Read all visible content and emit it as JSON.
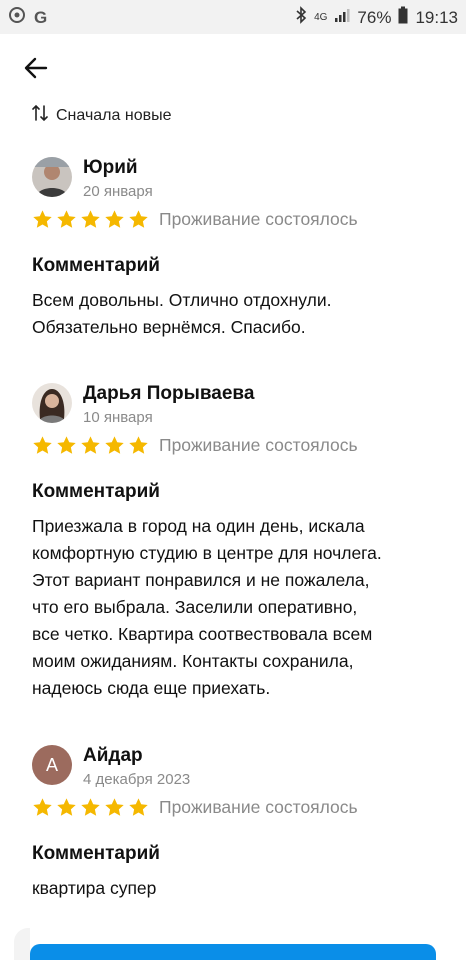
{
  "status_bar": {
    "battery": "76%",
    "time": "19:13",
    "network": "4G"
  },
  "sort": {
    "label": "Сначала новые"
  },
  "reviews": [
    {
      "name": "Юрий",
      "date": "20 января",
      "rating": 5,
      "stay": "Проживание состоялось",
      "comment_label": "Комментарий",
      "comment_lines": [
        "Всем довольны. Отлично отдохнули.",
        "Обязательно вернёмся. Спасибо."
      ]
    },
    {
      "name": "Дарья Порываева",
      "date": "10 января",
      "rating": 5,
      "stay": "Проживание состоялось",
      "comment_label": "Комментарий",
      "comment_lines": [
        "Приезжала в город на один день, искала",
        "комфортную студию в центре для ночлега.",
        "Этот вариант понравился и не пожалела,",
        "что его выбрала. Заселили оперативно,",
        "все четко. Квартира соотвествовала всем",
        "моим ожиданиям. Контакты сохранила,",
        "надеюсь сюда еще приехать."
      ]
    },
    {
      "name": "Айдар",
      "avatar_letter": "А",
      "date": "4 декабря 2023",
      "rating": 5,
      "stay": "Проживание состоялось",
      "comment_label": "Комментарий",
      "comment_lines": [
        "квартира супер"
      ]
    }
  ],
  "colors": {
    "star": "#f5b800",
    "accent": "#0a8ee8",
    "muted": "#8a8a8a",
    "avatar_letter_bg": "#9c6b5e"
  }
}
